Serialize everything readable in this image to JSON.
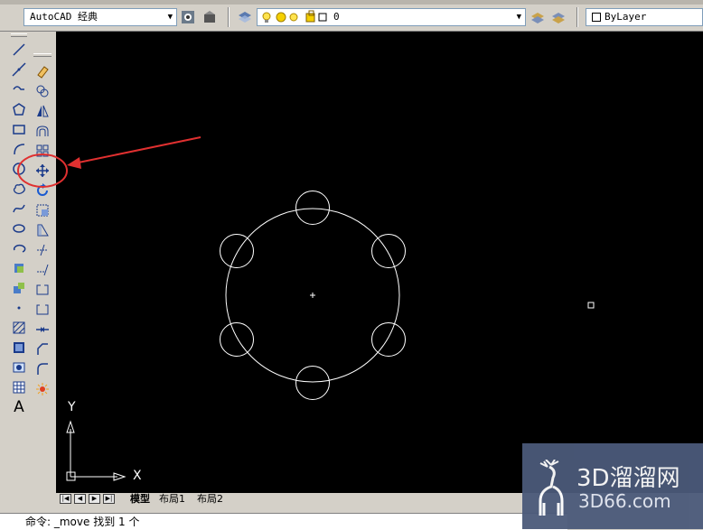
{
  "toolbar": {
    "workspace_value": "AutoCAD 经典",
    "layer_value": "0",
    "color_value": "ByLayer"
  },
  "tabs": {
    "model": "模型",
    "layout1": "布局1",
    "layout2": "布局2"
  },
  "ucs": {
    "y_label": "Y",
    "x_label": "X"
  },
  "command_line": {
    "text": "命令: _move 找到 1 个"
  },
  "watermark": {
    "brand": "3D溜溜网",
    "url": "3D66.com"
  },
  "annotation": {
    "color": "#e03030"
  },
  "drawing": {
    "main_circle_count": 1,
    "small_circle_count": 6
  }
}
